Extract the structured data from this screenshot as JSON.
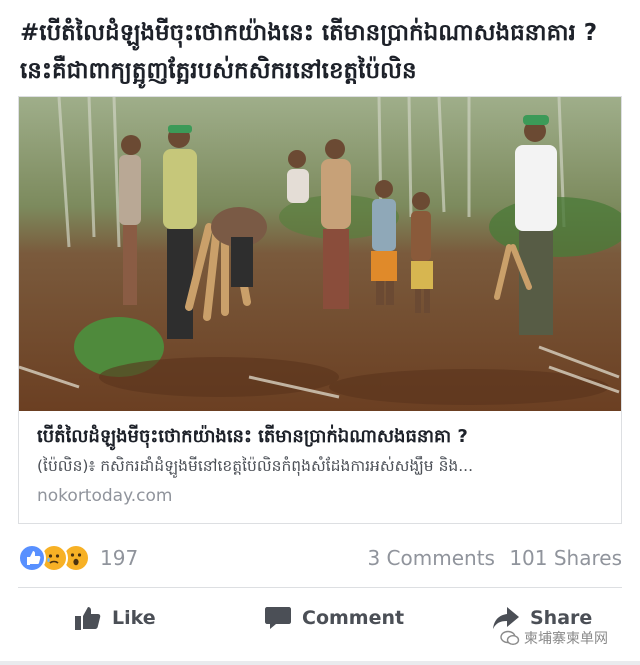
{
  "post": {
    "text": "#បើតំលៃដំឡូងមីចុះថោកយ៉ាងនេះ តើមានប្រាក់ឯណាសងធនាគារ ? នេះគឺជាពាក្យត្អូញត្អែរបស់កសិករនៅខេត្តប៉ៃលិន"
  },
  "link_card": {
    "title": "បើតំលៃដំឡូងមីចុះថោកយ៉ាងនេះ តើមានប្រាក់ឯណាសងធនាគា ?",
    "description": "(ប៉ៃលិន)៖ កសិករដាំដំឡូងមីនៅខេត្តប៉ៃលិនកំពុងសំដែងការអស់សង្ឃឹម និង...",
    "domain": "nokortoday.com"
  },
  "reactions": {
    "icons": [
      "like-reaction-icon",
      "sad-reaction-icon",
      "wow-reaction-icon"
    ],
    "count": "197",
    "colors": {
      "like": "#5890ff",
      "sad": "#f7b125",
      "wow": "#f7b125"
    }
  },
  "engagement": {
    "comments": "3 Comments",
    "shares": "101 Shares"
  },
  "actions": {
    "like": "Like",
    "comment": "Comment",
    "share": "Share"
  },
  "watermark": {
    "text": "柬埔寨柬单网"
  },
  "colors": {
    "text_primary": "#1d2129",
    "text_secondary": "#90949c",
    "action_text": "#4b4f56",
    "border": "#dddfe2"
  }
}
